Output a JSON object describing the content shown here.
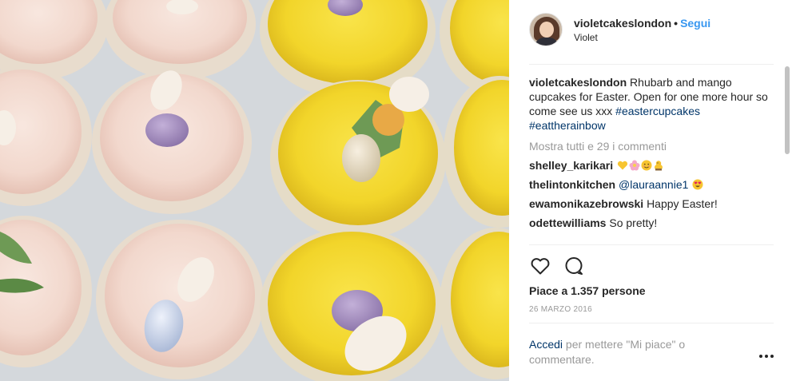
{
  "post": {
    "username": "violetcakeslondon",
    "separator": "•",
    "follow_label": "Segui",
    "display_name": "Violet"
  },
  "caption": {
    "username": "violetcakeslondon",
    "text": "Rhubarb and mango cupcakes for Easter. Open for one more hour so come see us xxx",
    "hashtags": "#eastercupcakes #eattherainbow"
  },
  "view_all_comments": "Mostra tutti e 29 i commenti",
  "comments": [
    {
      "username": "shelley_karikari",
      "text": "",
      "emojis": [
        "yellow-heart-icon",
        "blossom-icon",
        "smiling-face-icon",
        "chick-icon"
      ]
    },
    {
      "username": "thelintonkitchen",
      "mention": "@lauraannie1",
      "text": "",
      "emojis": [
        "heart-eyes-icon"
      ]
    },
    {
      "username": "ewamonikazebrowski",
      "text": "Happy Easter!",
      "emojis": []
    },
    {
      "username": "odettewilliams",
      "text": "So pretty!",
      "emojis": []
    }
  ],
  "actions": {
    "like_icon": "heart-outline-icon",
    "comment_icon": "comment-bubble-icon"
  },
  "likes_text": "Piace a 1.357 persone",
  "date_text": "26 MARZO 2016",
  "login_prompt": {
    "link": "Accedi",
    "rest": " per mettere \"Mi piace\" o commentare."
  },
  "more_icon": "more-options-icon",
  "colors": {
    "link_blue": "#3897f0",
    "hashtag_blue": "#003569",
    "muted_gray": "#999999",
    "text": "#262626",
    "frosting_pink": "#f3ddd4",
    "frosting_yellow": "#f5dc36"
  }
}
